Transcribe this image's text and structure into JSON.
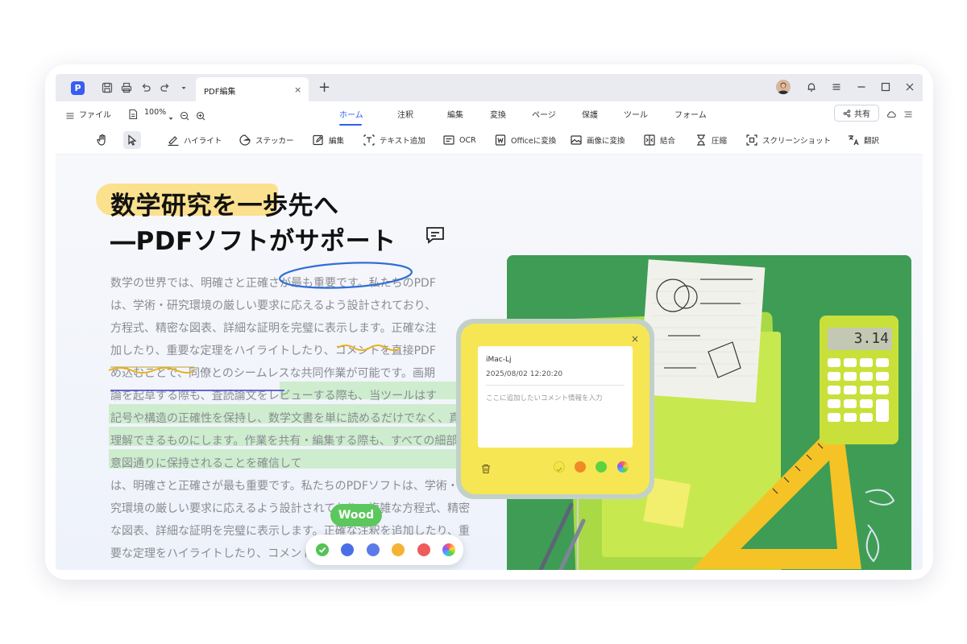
{
  "titlebar": {
    "tab_title": "PDF編集",
    "tab_close": "×",
    "new_tab": "+"
  },
  "menubar": {
    "file_label": "ファイル",
    "zoom_value": "100%",
    "tabs": [
      "ホーム",
      "注釈",
      "編集",
      "変換",
      "ページ",
      "保護",
      "ツール",
      "フォーム"
    ],
    "active_tab": "ホーム",
    "share_label": "共有"
  },
  "toolbar": {
    "highlight": "ハイライト",
    "sticker": "ステッカー",
    "edit": "編集",
    "add_text": "テキスト追加",
    "ocr": "OCR",
    "to_office": "Officeに変換",
    "to_image": "画像に変換",
    "combine": "結合",
    "compress": "圧縮",
    "screenshot": "スクリーンショット",
    "translate": "翻訳"
  },
  "document": {
    "heading_line1": "数学研究を一歩先へ",
    "heading_line2": "―PDFソフトがサポート",
    "body_lines": [
      "数学の世界では、明確さと正確さが最も重要です。私たちのPDF",
      "は、学術・研究環境の厳しい要求に応えるよう設計されており、",
      "方程式、精密な図表、詳細な証明を完璧に表示します。正確な注",
      "加したり、重要な定理をハイライトしたり、コメントを直接PDF",
      "め込むことで、同僚とのシームレスな共同作業が可能です。画期",
      "論を起草する際も、査読論文をレビューする際も、当ツールはす",
      "記号や構造の正確性を保持し、数学文書を単に読めるだけでなく、真に",
      "理解できるものにします。作業を共有・編集する際も、すべての細部が",
      "意図通りに保持されることを確信して",
      "は、明確さと正確さが最も重要です。私たちのPDFソフトは、学術・研",
      "究環境の厳しい要求に応えるよう設計されており、複雑な方程式、精密",
      "な図表、詳細な証明を完璧に表示します。正確な注釈を追加したり、重",
      "要な定理をハイライトしたり、コメントを直接PDF内に埋め込むこと"
    ]
  },
  "highlight_picker": {
    "tag_label": "Wood",
    "colors": [
      "#55c255",
      "#4a6ee8",
      "#5b7be8",
      "#f4b334",
      "#ef5b5b",
      "rainbow"
    ]
  },
  "sticky_note": {
    "user": "iMac-Lj",
    "timestamp": "2025/08/02 12:20:20",
    "placeholder": "ここに追加したいコメント情報を入力",
    "close": "×",
    "colors": [
      "#f2e64a",
      "#ef8a27",
      "#5ed33f",
      "rainbow"
    ]
  },
  "photo": {
    "calculator_display": "3.14"
  }
}
